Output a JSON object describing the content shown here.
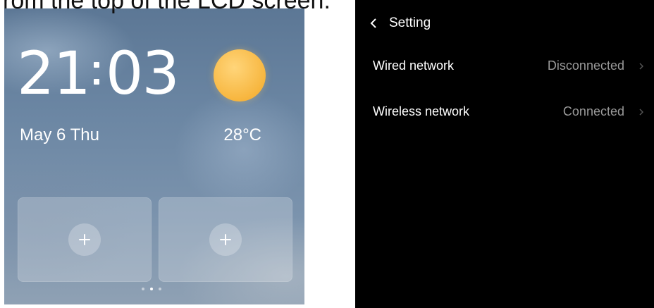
{
  "caption": "rom the top of the LCD screen.",
  "home": {
    "clock": {
      "hours": "21",
      "minutes": "03"
    },
    "date": "May 6 Thu",
    "temperature": "28°C",
    "weather_icon": "sun-icon",
    "shortcuts": [
      {
        "icon": "plus-icon"
      },
      {
        "icon": "plus-icon"
      }
    ],
    "pager": {
      "pages": 3,
      "active_index": 1
    }
  },
  "settings": {
    "title": "Setting",
    "back_icon": "chevron-left-icon",
    "rows": [
      {
        "label": "Wired network",
        "value": "Disconnected",
        "icon": "chevron-right-icon"
      },
      {
        "label": "Wireless network",
        "value": "Connected",
        "icon": "chevron-right-icon"
      }
    ]
  },
  "colors": {
    "settings_background": "#000000",
    "secondary_text": "#9a9a9a",
    "sun": "#f7b63f"
  }
}
